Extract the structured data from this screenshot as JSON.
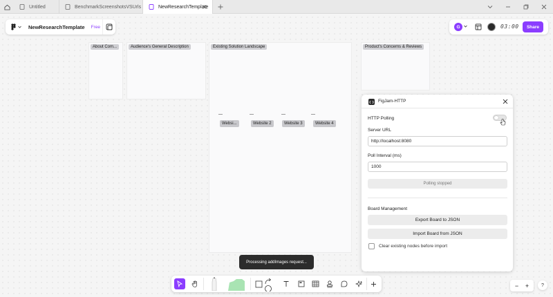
{
  "tabs": [
    {
      "label": "Untitled",
      "active": false
    },
    {
      "label": "BenchmarkScreenshotsVSUrls",
      "active": false
    },
    {
      "label": "NewResearchTemplate",
      "active": true
    }
  ],
  "file": {
    "name": "NewResearchTemplate",
    "plan": "Free"
  },
  "toolbar_right": {
    "avatar_initial": "G",
    "timer": "03:00",
    "share_label": "Share"
  },
  "sections": [
    {
      "label": "About Com..."
    },
    {
      "label": "Audience's General Description"
    },
    {
      "label": "Existing Solution Landscape"
    },
    {
      "label": "Product's Concerns & Reviews"
    }
  ],
  "websites": [
    "Websi...",
    "Website 2",
    "Website 3",
    "Website 4"
  ],
  "plugin": {
    "title": "FigJam-HTTP",
    "polling_label": "HTTP Polling",
    "server_url_label": "Server URL",
    "server_url_value": "http://localhost:8080",
    "poll_interval_label": "Poll Interval (ms)",
    "poll_interval_value": "1000",
    "status": "Polling stopped",
    "board_management_label": "Board Management",
    "export_label": "Export Board to JSON",
    "import_label": "Import Board from JSON",
    "clear_label": "Clear existing nodes before import"
  },
  "toast": "Processing addImages request...",
  "zoom": {
    "minus": "−",
    "plus": "+"
  },
  "help": "?",
  "colors": {
    "accent": "#8b3dff",
    "toast_bg": "#2c2c2c"
  }
}
